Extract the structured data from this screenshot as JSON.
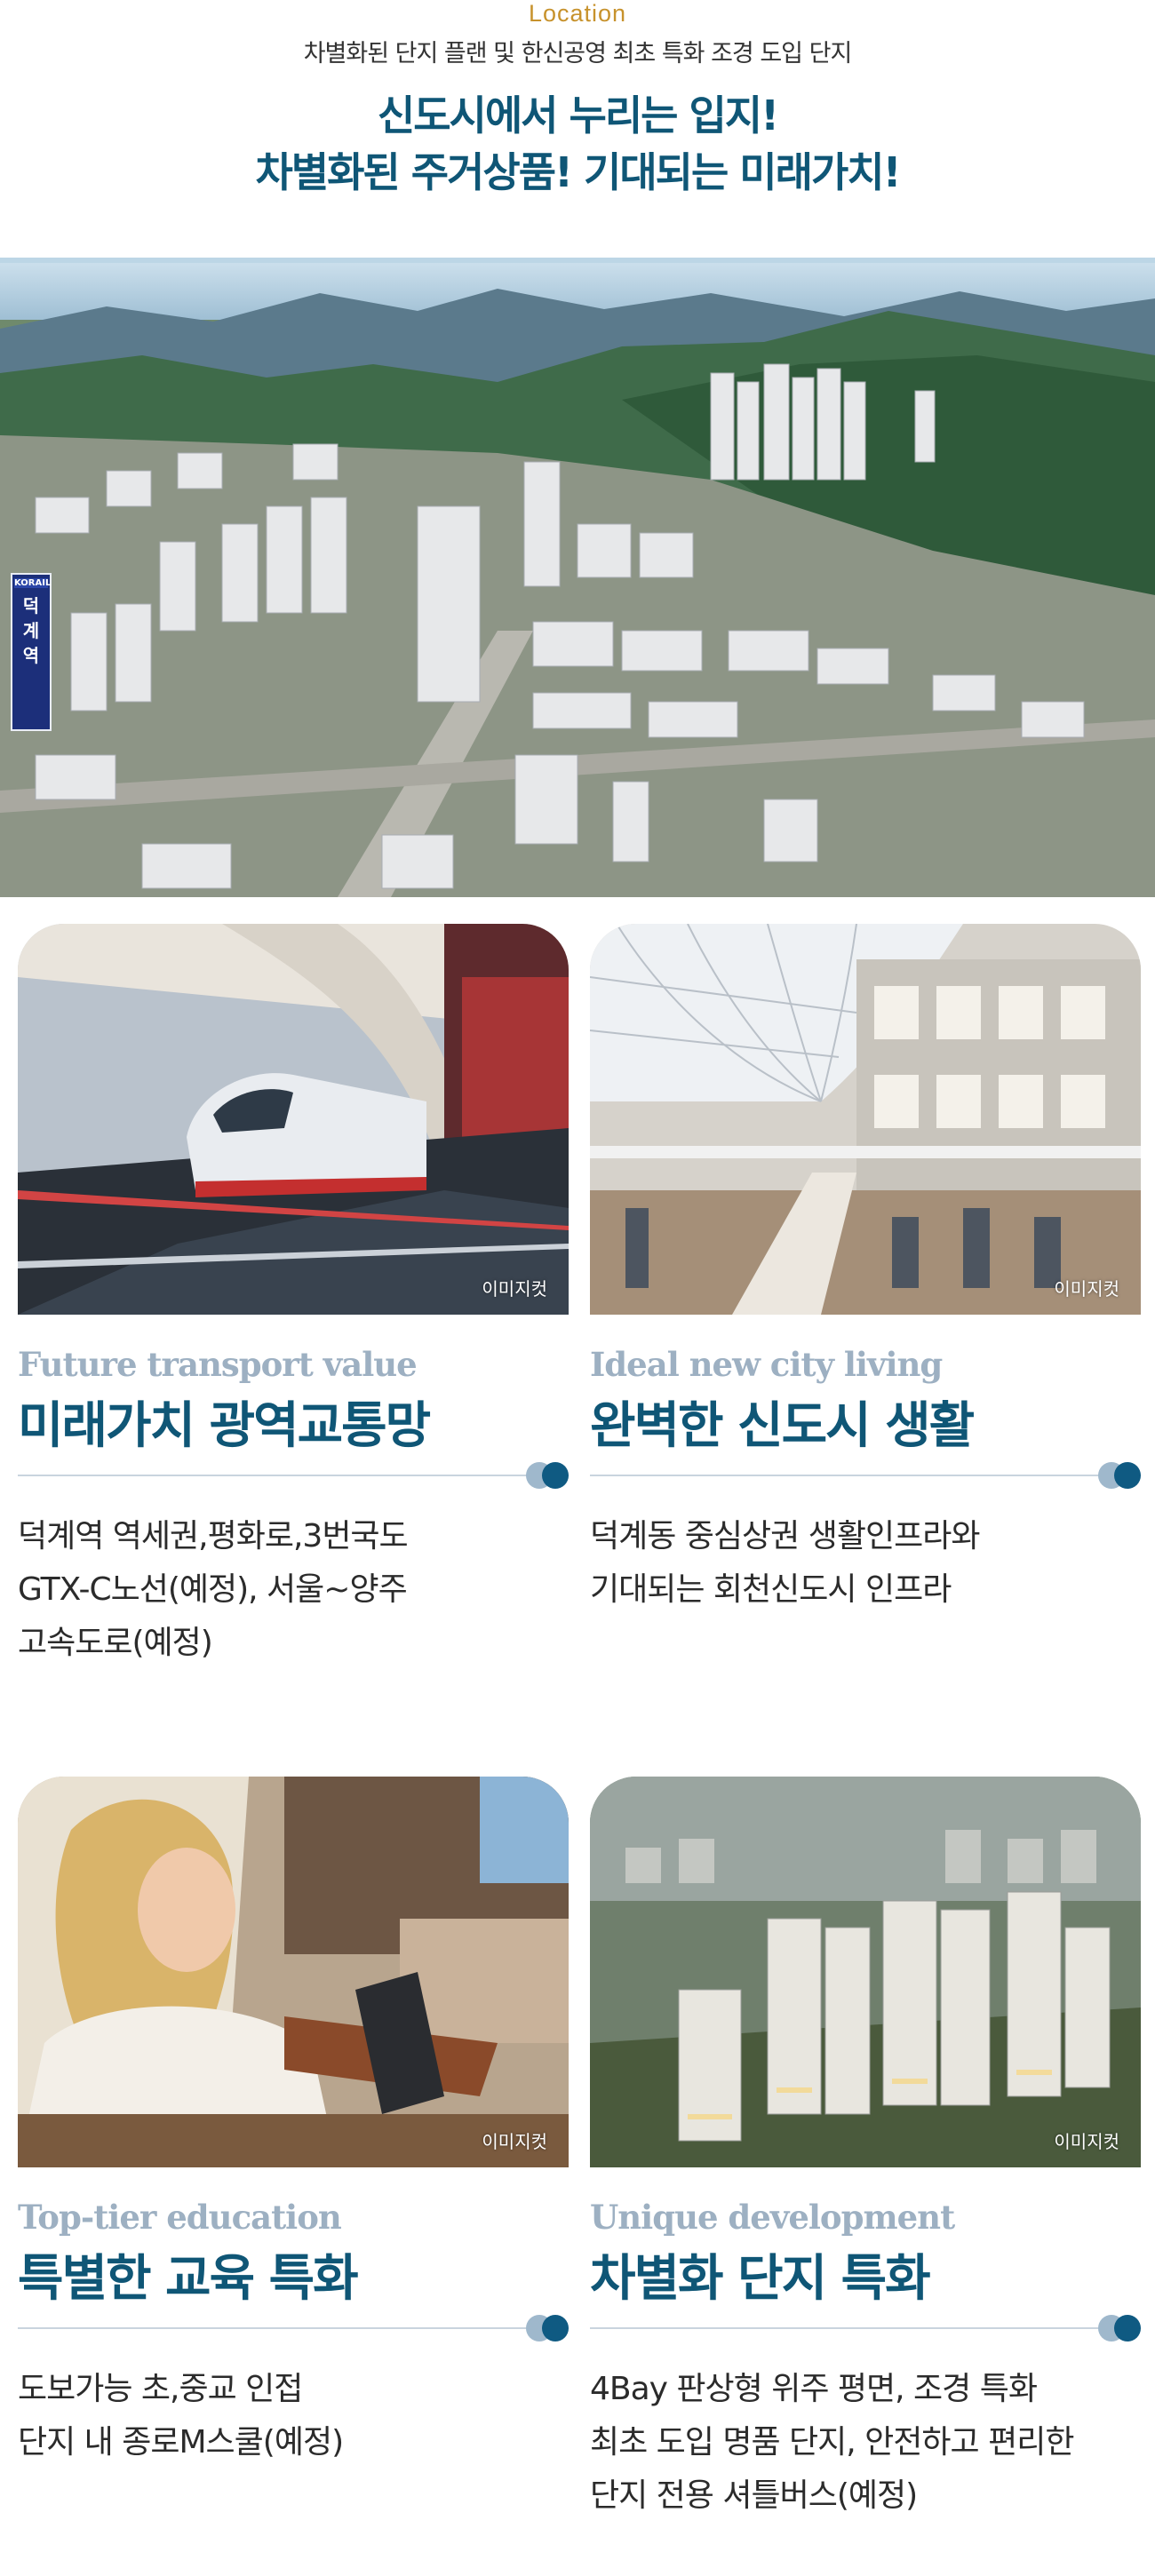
{
  "header": {
    "eyebrow": "Location",
    "subtitle": "차별화된 단지 플랜 및 한신공영 최초 특화 조경 도입 단지",
    "title_line1": "신도시에서 누리는 입지!",
    "title_line2": "차별화된 주거상품!  기대되는 미래가치!"
  },
  "hero": {
    "station_brand": "KORAIL",
    "station_name": [
      "덕",
      "계",
      "역"
    ]
  },
  "cards": [
    {
      "image_caption": "이미지컷",
      "en_title": "Future transport value",
      "ko_title": "미래가치 광역교통망",
      "desc": [
        "덕계역 역세권,평화로,3번국도",
        "GTX-C노선(예정), 서울~양주",
        "고속도로(예정)"
      ]
    },
    {
      "image_caption": "이미지컷",
      "en_title": "Ideal new city living",
      "ko_title": "완벽한 신도시 생활",
      "desc": [
        "덕계동 중심상권 생활인프라와",
        "기대되는 회천신도시 인프라"
      ]
    },
    {
      "image_caption": "이미지컷",
      "en_title": "Top-tier education",
      "ko_title": "특별한 교육 특화",
      "desc": [
        "도보가능 초,중교 인접",
        "단지 내 종로M스쿨(예정)"
      ]
    },
    {
      "image_caption": "이미지컷",
      "en_title": "Unique development",
      "ko_title": "차별화 단지 특화",
      "desc": [
        "4Bay 판상형 위주 평면, 조경 특화",
        "최초 도입 명품 단지, 안전하고 편리한",
        "단지 전용 셔틀버스(예정)"
      ]
    }
  ],
  "colors": {
    "brand_navy": "#0f5676",
    "accent_gold": "#c7922c",
    "en_title_gray": "#9db0c2"
  }
}
